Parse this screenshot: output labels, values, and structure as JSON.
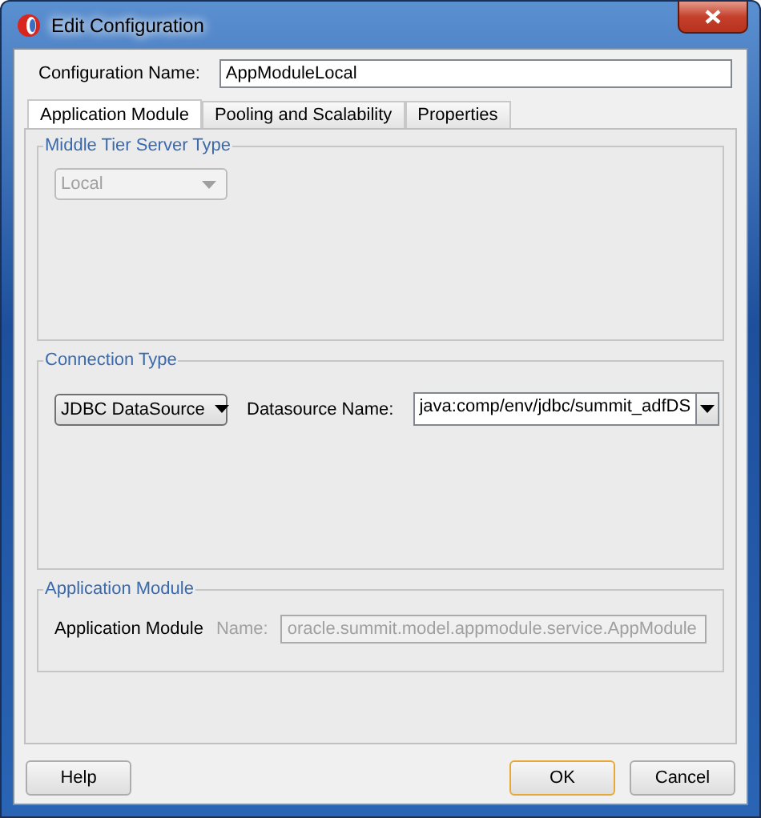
{
  "window": {
    "title": "Edit Configuration"
  },
  "configuration_name": {
    "label": "Configuration Name:",
    "value": "AppModuleLocal"
  },
  "tabs": [
    {
      "label": "Application Module",
      "selected": true
    },
    {
      "label": "Pooling and Scalability",
      "selected": false
    },
    {
      "label": "Properties",
      "selected": false
    }
  ],
  "middle_tier": {
    "title": "Middle Tier Server Type",
    "combo": {
      "value": "Local",
      "disabled": true
    }
  },
  "connection": {
    "title": "Connection Type",
    "combo": {
      "value": "JDBC DataSource",
      "disabled": false
    },
    "datasource_label": "Datasource Name:",
    "datasource_value": "java:comp/env/jdbc/summit_adfDS"
  },
  "application_module": {
    "title": "Application Module",
    "label": "Application Module",
    "name_label": "Name:",
    "name_value": "oracle.summit.model.appmodule.service.AppModule",
    "disabled": true
  },
  "buttons": [
    {
      "label": "Help",
      "kind": "left",
      "default": false
    },
    {
      "label": "OK",
      "kind": "right",
      "default": true
    },
    {
      "label": "Cancel",
      "kind": "right",
      "default": false
    }
  ]
}
